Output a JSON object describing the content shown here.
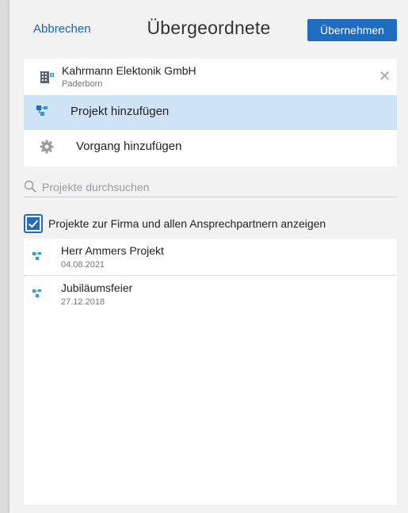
{
  "header": {
    "cancel_label": "Abbrechen",
    "title": "Übergeordnete",
    "apply_label": "Übernehmen"
  },
  "company": {
    "name": "Kahrmann Elektonik GmbH",
    "city": "Paderborn",
    "icon": "building-icon",
    "clear_icon": "close-icon"
  },
  "actions": [
    {
      "label": "Projekt hinzufügen",
      "icon": "project-icon",
      "selected": true
    },
    {
      "label": "Vorgang hinzufügen",
      "icon": "gear-icon",
      "selected": false
    }
  ],
  "search": {
    "placeholder": "Projekte durchsuchen",
    "value": ""
  },
  "filter": {
    "label": "Projekte zur Firma und allen Ansprechpartnern anzeigen",
    "checked": true
  },
  "projects": [
    {
      "title": "Herr Ammers Projekt",
      "date": "04.08.2021"
    },
    {
      "title": "Jubiläumsfeier",
      "date": "27.12.2018"
    }
  ],
  "colors": {
    "accent": "#1f6cc0",
    "link": "#1565c0",
    "selected_row": "#cfe3f6",
    "project_icon": "#2a9fd8"
  }
}
